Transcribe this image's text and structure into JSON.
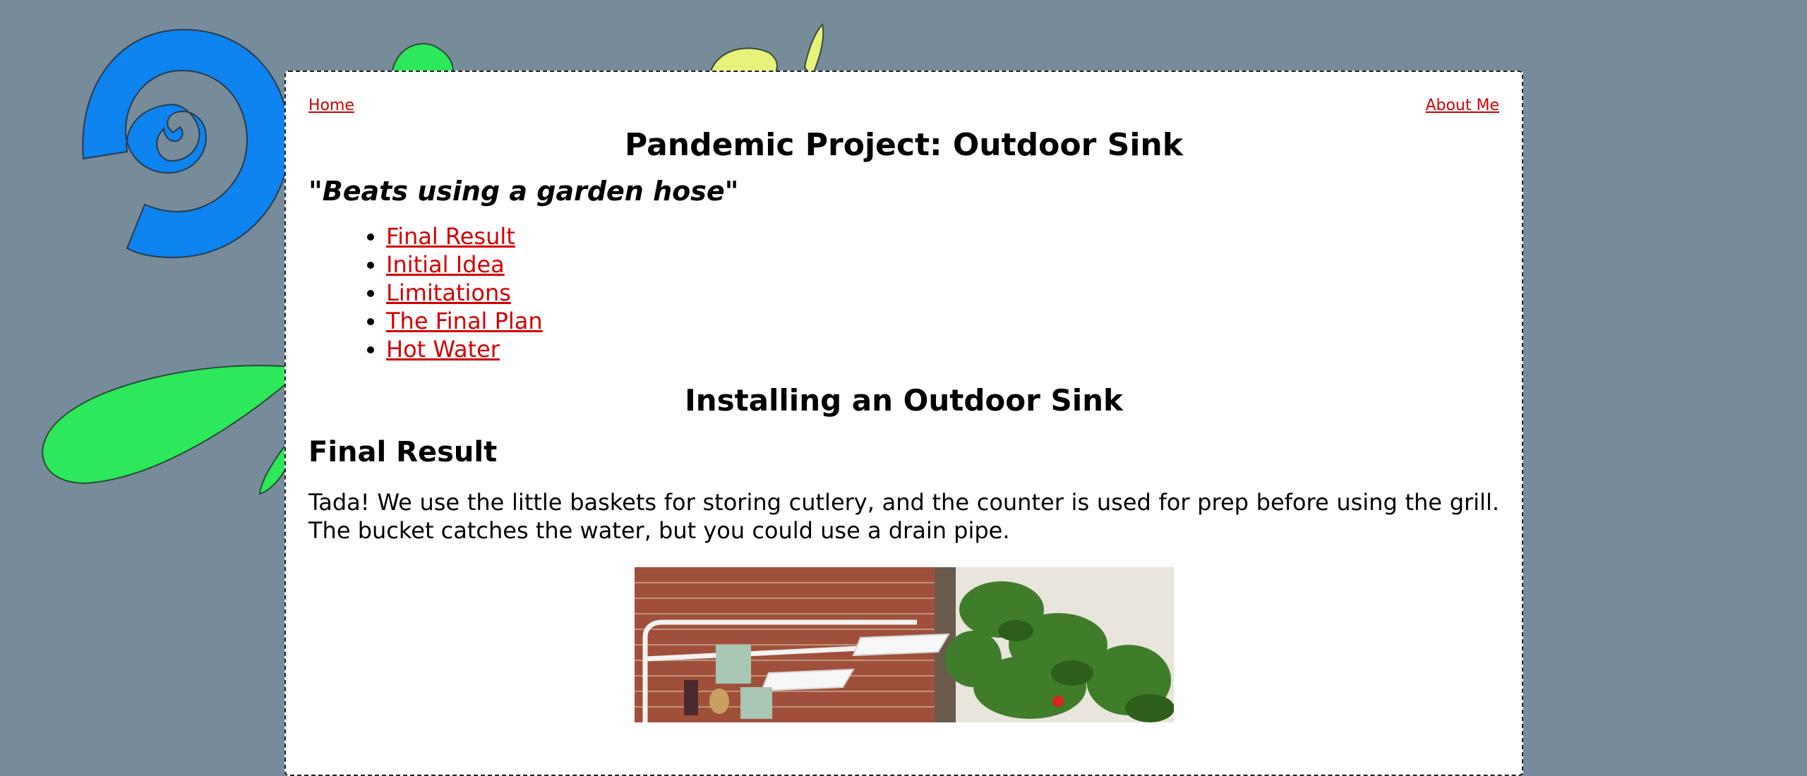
{
  "nav": {
    "home": "Home",
    "about": "About Me"
  },
  "page": {
    "title": "Pandemic Project: Outdoor Sink",
    "tagline": "\"Beats using a garden hose\""
  },
  "toc": [
    "Final Result",
    "Initial Idea",
    "Limitations",
    "The Final Plan",
    "Hot Water"
  ],
  "section": {
    "title": "Installing an Outdoor Sink",
    "subtitle": "Final Result",
    "body": "Tada! We use the little baskets for storing cutlery, and the counter is used for prep before using the grill. The bucket catches the water, but you could use a drain pipe."
  },
  "colors": {
    "background": "#778c9b",
    "link": "#d40000",
    "spiral": "#0d84f0",
    "leaf_green": "#2ce85a",
    "leaf_yellow": "#e8f27a"
  }
}
